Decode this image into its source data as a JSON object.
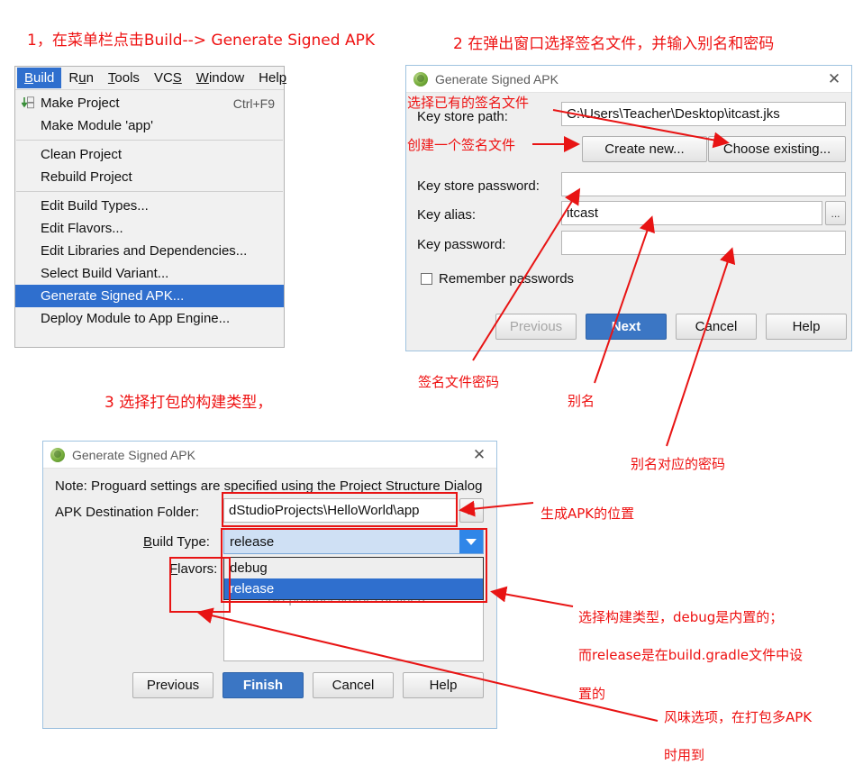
{
  "steps": {
    "step1": "1，在菜单栏点击Build--> Generate Signed APK",
    "step2": "2 在弹出窗口选择签名文件，并输入别名和密码",
    "step3": "3 选择打包的构建类型，"
  },
  "build_menu": {
    "menubar": [
      {
        "label": "Build",
        "selected": true
      },
      {
        "label": "Run",
        "selected": false
      },
      {
        "label": "Tools",
        "selected": false
      },
      {
        "label": "VCS",
        "selected": false
      },
      {
        "label": "Window",
        "selected": false
      },
      {
        "label": "Help",
        "selected": false
      }
    ],
    "items": [
      {
        "label": "Make Project",
        "accel": "Ctrl+F9",
        "icon": "make-project-icon",
        "highlighted": false
      },
      {
        "label": "Make Module 'app'",
        "accel": "",
        "icon": "",
        "highlighted": false
      },
      {
        "separator": true
      },
      {
        "label": "Clean Project",
        "accel": "",
        "icon": "",
        "highlighted": false
      },
      {
        "label": "Rebuild Project",
        "accel": "",
        "icon": "",
        "highlighted": false
      },
      {
        "separator": true
      },
      {
        "label": "Edit Build Types...",
        "accel": "",
        "icon": "",
        "highlighted": false
      },
      {
        "label": "Edit Flavors...",
        "accel": "",
        "icon": "",
        "highlighted": false
      },
      {
        "label": "Edit Libraries and Dependencies...",
        "accel": "",
        "icon": "",
        "highlighted": false
      },
      {
        "label": "Select Build Variant...",
        "accel": "",
        "icon": "",
        "highlighted": false
      },
      {
        "label": "Generate Signed APK...",
        "accel": "",
        "icon": "",
        "highlighted": true
      },
      {
        "label": "Deploy Module to App Engine...",
        "accel": "",
        "icon": "",
        "highlighted": false
      }
    ]
  },
  "dialog_keystore": {
    "title": "Generate Signed APK",
    "close_label": "✕",
    "fields": {
      "keystore_path_label": "Key store path:",
      "keystore_path_value": "C:\\Users\\Teacher\\Desktop\\itcast.jks",
      "create_new_label": "Create new...",
      "choose_existing_label": "Choose existing...",
      "keystore_password_label": "Key store password:",
      "keystore_password_value": "",
      "key_alias_label": "Key alias:",
      "key_alias_value": "itcast",
      "alias_browse_label": "...",
      "key_password_label": "Key password:",
      "key_password_value": "",
      "remember_label": "Remember passwords"
    },
    "buttons": {
      "previous": "Previous",
      "next": "Next",
      "cancel": "Cancel",
      "help": "Help"
    }
  },
  "dialog_apk": {
    "title": "Generate Signed APK",
    "close_label": "✕",
    "note": "Note: Proguard settings are specified using the Project Structure Dialog",
    "fields": {
      "dest_folder_label": "APK Destination Folder:",
      "dest_folder_value": "dStudioProjects\\HelloWorld\\app",
      "dest_browse_label": "...",
      "build_type_label": "Build Type:",
      "build_type_value": "release",
      "build_type_options": [
        "debug",
        "release"
      ],
      "build_type_selected": "release",
      "flavors_label": "Flavors:",
      "flavors_empty": "No product flavors defined"
    },
    "buttons": {
      "previous": "Previous",
      "finish": "Finish",
      "cancel": "Cancel",
      "help": "Help"
    }
  },
  "annotations": {
    "choose_existing_note": "选择已有的签名文件",
    "create_new_note": "创建一个签名文件",
    "keystore_pwd_note": "签名文件密码",
    "alias_note": "别名",
    "alias_pwd_note": "别名对应的密码",
    "apk_location_note": "生成APK的位置",
    "build_type_note_line1": "选择构建类型，debug是内置的；",
    "build_type_note_line2": "而release是在build.gradle文件中设",
    "build_type_note_line3": "置的",
    "flavors_note_line1": "风味选项，在打包多APK",
    "flavors_note_line2": "时用到"
  },
  "colors": {
    "annotation_red": "#ee1111",
    "highlight_blue": "#2f6fce",
    "primary_button": "#3b76c4",
    "dialog_bg": "#efefef"
  }
}
